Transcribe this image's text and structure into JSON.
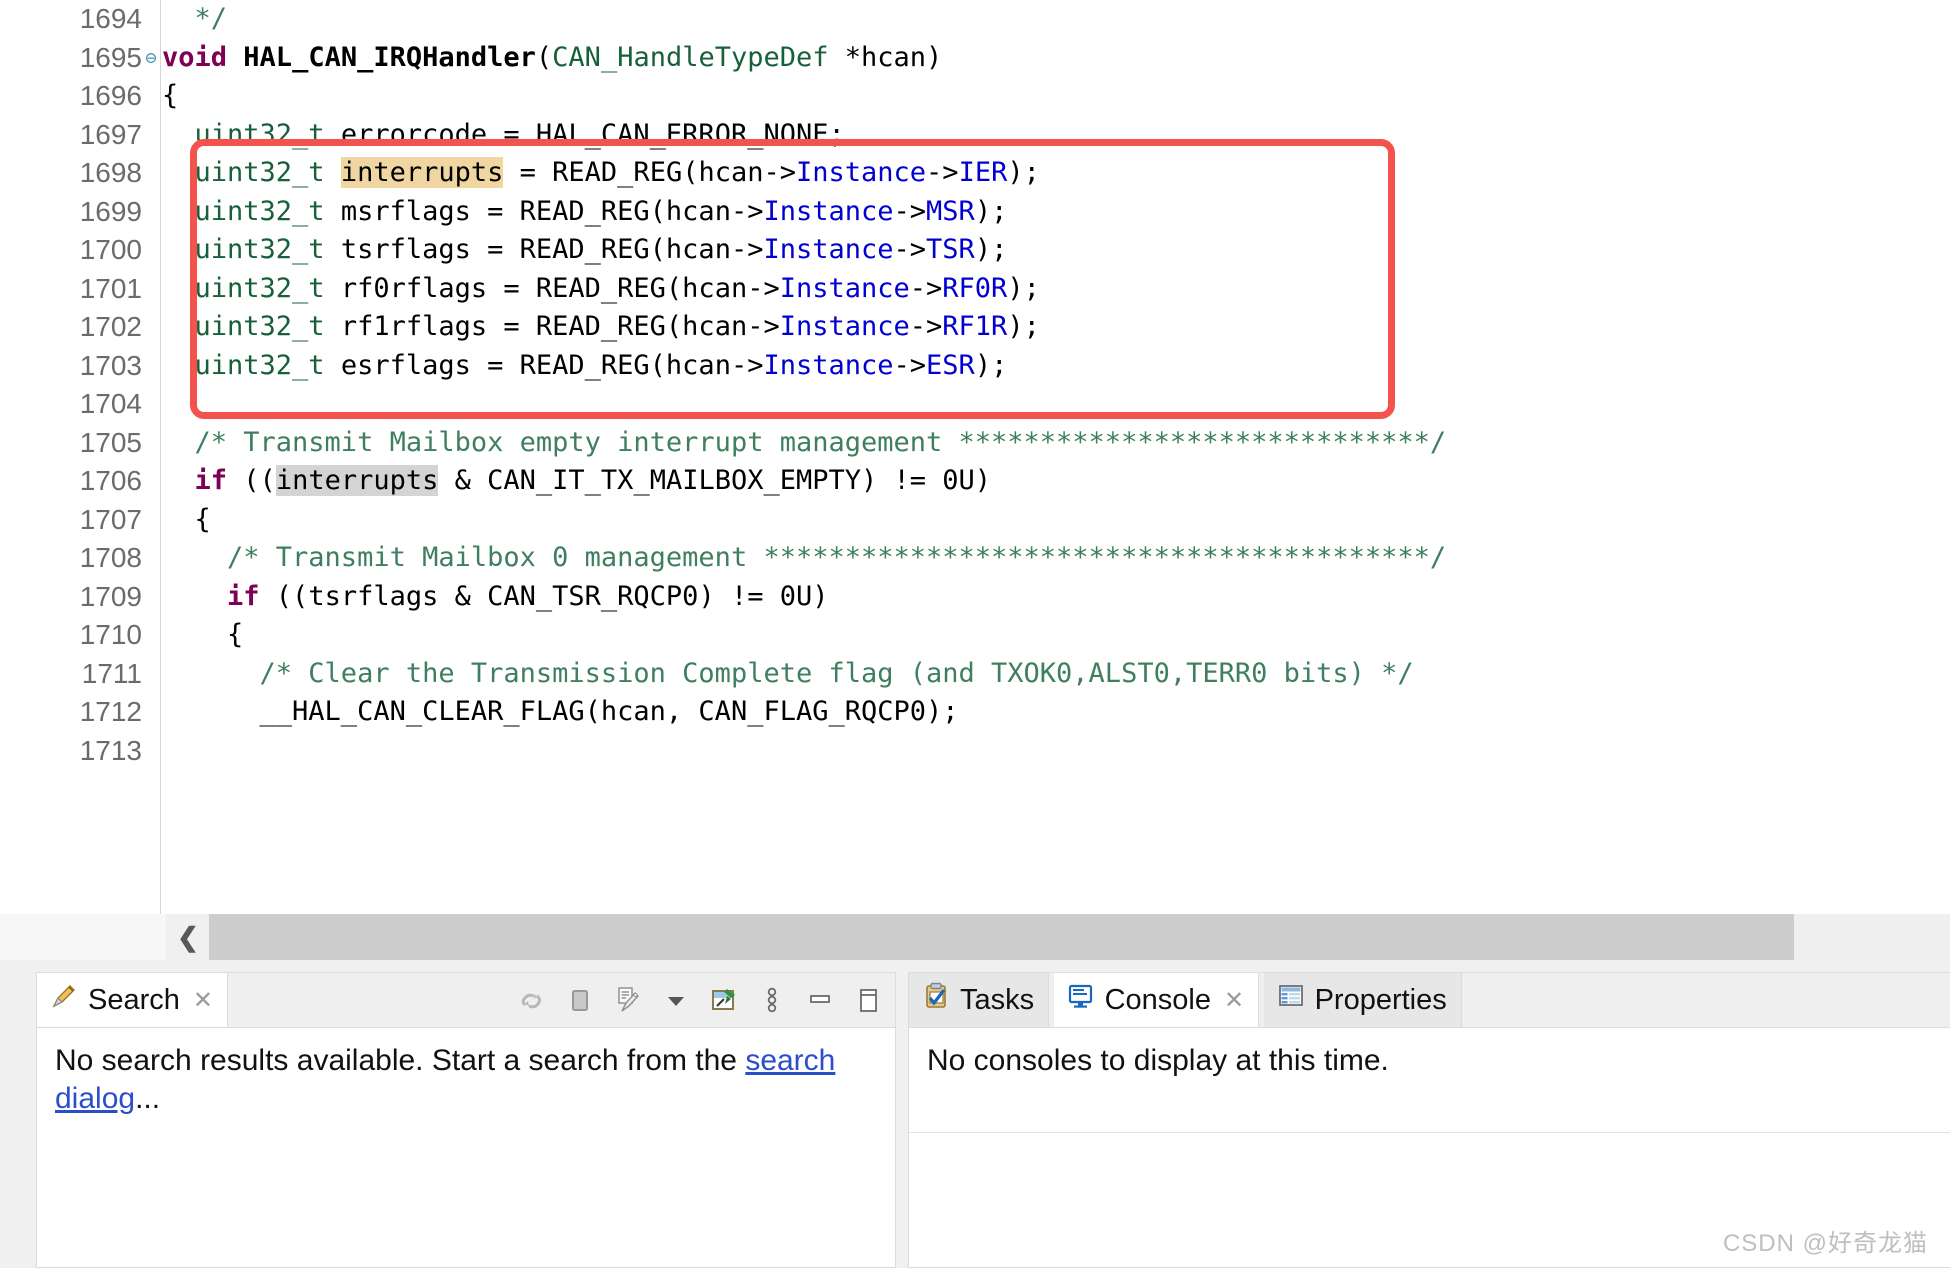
{
  "editor": {
    "first_line": 1694,
    "font_size_px": 27,
    "lines": [
      {
        "num": "1694",
        "fold": false,
        "tokens": [
          {
            "t": "  ",
            "c": "plain"
          },
          {
            "t": "*/",
            "c": "cmt"
          }
        ]
      },
      {
        "num": "1695",
        "fold": true,
        "tokens": [
          {
            "t": "void",
            "c": "kw"
          },
          {
            "t": " ",
            "c": "plain"
          },
          {
            "t": "HAL_CAN_IRQHandler",
            "c": "fn"
          },
          {
            "t": "(",
            "c": "plain"
          },
          {
            "t": "CAN_HandleTypeDef",
            "c": "type"
          },
          {
            "t": " *hcan)",
            "c": "plain"
          }
        ]
      },
      {
        "num": "1696",
        "fold": false,
        "tokens": [
          {
            "t": "{",
            "c": "plain"
          }
        ]
      },
      {
        "num": "1697",
        "fold": false,
        "tokens": [
          {
            "t": "  ",
            "c": "plain"
          },
          {
            "t": "uint32_t",
            "c": "type"
          },
          {
            "t": " errorcode = HAL_CAN_ERROR_NONE;",
            "c": "plain"
          }
        ]
      },
      {
        "num": "1698",
        "fold": false,
        "tokens": [
          {
            "t": "  ",
            "c": "plain"
          },
          {
            "t": "uint32_t",
            "c": "type"
          },
          {
            "t": " ",
            "c": "plain"
          },
          {
            "t": "interrupts",
            "c": "plain hl-write"
          },
          {
            "t": " = READ_REG(hcan->",
            "c": "plain"
          },
          {
            "t": "Instance",
            "c": "field"
          },
          {
            "t": "->",
            "c": "plain"
          },
          {
            "t": "IER",
            "c": "field"
          },
          {
            "t": ");",
            "c": "plain"
          }
        ]
      },
      {
        "num": "1699",
        "fold": false,
        "tokens": [
          {
            "t": "  ",
            "c": "plain"
          },
          {
            "t": "uint32_t",
            "c": "type"
          },
          {
            "t": " msrflags = READ_REG(hcan->",
            "c": "plain"
          },
          {
            "t": "Instance",
            "c": "field"
          },
          {
            "t": "->",
            "c": "plain"
          },
          {
            "t": "MSR",
            "c": "field"
          },
          {
            "t": ");",
            "c": "plain"
          }
        ]
      },
      {
        "num": "1700",
        "fold": false,
        "tokens": [
          {
            "t": "  ",
            "c": "plain"
          },
          {
            "t": "uint32_t",
            "c": "type"
          },
          {
            "t": " tsrflags = READ_REG(hcan->",
            "c": "plain"
          },
          {
            "t": "Instance",
            "c": "field"
          },
          {
            "t": "->",
            "c": "plain"
          },
          {
            "t": "TSR",
            "c": "field"
          },
          {
            "t": ");",
            "c": "plain"
          }
        ]
      },
      {
        "num": "1701",
        "fold": false,
        "tokens": [
          {
            "t": "  ",
            "c": "plain"
          },
          {
            "t": "uint32_t",
            "c": "type"
          },
          {
            "t": " rf0rflags = READ_REG(hcan->",
            "c": "plain"
          },
          {
            "t": "Instance",
            "c": "field"
          },
          {
            "t": "->",
            "c": "plain"
          },
          {
            "t": "RF0R",
            "c": "field"
          },
          {
            "t": ");",
            "c": "plain"
          }
        ]
      },
      {
        "num": "1702",
        "fold": false,
        "tokens": [
          {
            "t": "  ",
            "c": "plain"
          },
          {
            "t": "uint32_t",
            "c": "type"
          },
          {
            "t": " rf1rflags = READ_REG(hcan->",
            "c": "plain"
          },
          {
            "t": "Instance",
            "c": "field"
          },
          {
            "t": "->",
            "c": "plain"
          },
          {
            "t": "RF1R",
            "c": "field"
          },
          {
            "t": ");",
            "c": "plain"
          }
        ]
      },
      {
        "num": "1703",
        "fold": false,
        "tokens": [
          {
            "t": "  ",
            "c": "plain"
          },
          {
            "t": "uint32_t",
            "c": "type"
          },
          {
            "t": " esrflags = READ_REG(hcan->",
            "c": "plain"
          },
          {
            "t": "Instance",
            "c": "field"
          },
          {
            "t": "->",
            "c": "plain"
          },
          {
            "t": "ESR",
            "c": "field"
          },
          {
            "t": ");",
            "c": "plain"
          }
        ]
      },
      {
        "num": "1704",
        "fold": false,
        "tokens": [
          {
            "t": "",
            "c": "plain"
          }
        ]
      },
      {
        "num": "1705",
        "fold": false,
        "tokens": [
          {
            "t": "  /* Transmit Mailbox empty interrupt management *****************************/",
            "c": "cmt"
          }
        ]
      },
      {
        "num": "1706",
        "fold": false,
        "tokens": [
          {
            "t": "  ",
            "c": "plain"
          },
          {
            "t": "if",
            "c": "kw"
          },
          {
            "t": " ((",
            "c": "plain"
          },
          {
            "t": "interrupts",
            "c": "plain hl-occ"
          },
          {
            "t": " & CAN_IT_TX_MAILBOX_EMPTY) != 0U)",
            "c": "plain"
          }
        ]
      },
      {
        "num": "1707",
        "fold": false,
        "tokens": [
          {
            "t": "  {",
            "c": "plain"
          }
        ]
      },
      {
        "num": "1708",
        "fold": false,
        "tokens": [
          {
            "t": "    /* Transmit Mailbox 0 management *****************************************/",
            "c": "cmt"
          }
        ]
      },
      {
        "num": "1709",
        "fold": false,
        "tokens": [
          {
            "t": "    ",
            "c": "plain"
          },
          {
            "t": "if",
            "c": "kw"
          },
          {
            "t": " ((tsrflags & CAN_TSR_RQCP0) != 0U)",
            "c": "plain"
          }
        ]
      },
      {
        "num": "1710",
        "fold": false,
        "tokens": [
          {
            "t": "    {",
            "c": "plain"
          }
        ]
      },
      {
        "num": "1711",
        "fold": false,
        "tokens": [
          {
            "t": "      /* Clear the Transmission Complete flag (and TXOK0,ALST0,TERR0 bits) */",
            "c": "cmt"
          }
        ]
      },
      {
        "num": "1712",
        "fold": false,
        "tokens": [
          {
            "t": "      __HAL_CAN_CLEAR_FLAG(hcan, CAN_FLAG_RQCP0);",
            "c": "plain"
          }
        ]
      },
      {
        "num": "1713",
        "fold": false,
        "tokens": [
          {
            "t": "",
            "c": "plain"
          }
        ]
      }
    ],
    "fold_glyph": "⊖",
    "hscroll": {
      "left_arrow": "❮"
    }
  },
  "annotation": {
    "box_color": "#f4534d",
    "covers_lines": "1697-1703"
  },
  "search_panel": {
    "tab_label": "Search",
    "tab_icon": "search-pencil-icon",
    "close_glyph": "✕",
    "message_prefix": "No search results available. Start a search from the ",
    "message_link": "search dialog",
    "message_suffix": "...",
    "toolbar": [
      {
        "name": "rerun-search-icon",
        "glyph": "↺"
      },
      {
        "name": "stop-icon",
        "glyph": "■"
      },
      {
        "name": "clear-search-results-icon",
        "glyph": "✎"
      },
      {
        "name": "dropdown-arrow-icon",
        "glyph": "▼"
      },
      {
        "name": "pin-search-view-icon",
        "glyph": "⚑"
      },
      {
        "name": "view-menu-icon",
        "glyph": "⋮"
      },
      {
        "name": "minimize-icon",
        "glyph": "━"
      },
      {
        "name": "maximize-icon",
        "glyph": "❐"
      }
    ]
  },
  "console_panel": {
    "tabs": [
      {
        "label": "Tasks",
        "icon": "tasks-clipboard-icon",
        "active": false,
        "closable": false
      },
      {
        "label": "Console",
        "icon": "console-monitor-icon",
        "active": true,
        "closable": true
      },
      {
        "label": "Properties",
        "icon": "properties-table-icon",
        "active": false,
        "closable": false
      }
    ],
    "close_glyph": "✕",
    "message": "No consoles to display at this time."
  },
  "watermark": {
    "text": "CSDN @好奇龙猫"
  },
  "colors": {
    "keyword": "#7f0055",
    "type": "#18603a",
    "field": "#0000d0",
    "comment": "#3f7f5f",
    "annotation_red": "#f4534d",
    "write_occurrence": "#f0d6a0",
    "read_occurrence": "#d4d4d4",
    "change_bar": "#1f7bc2"
  }
}
